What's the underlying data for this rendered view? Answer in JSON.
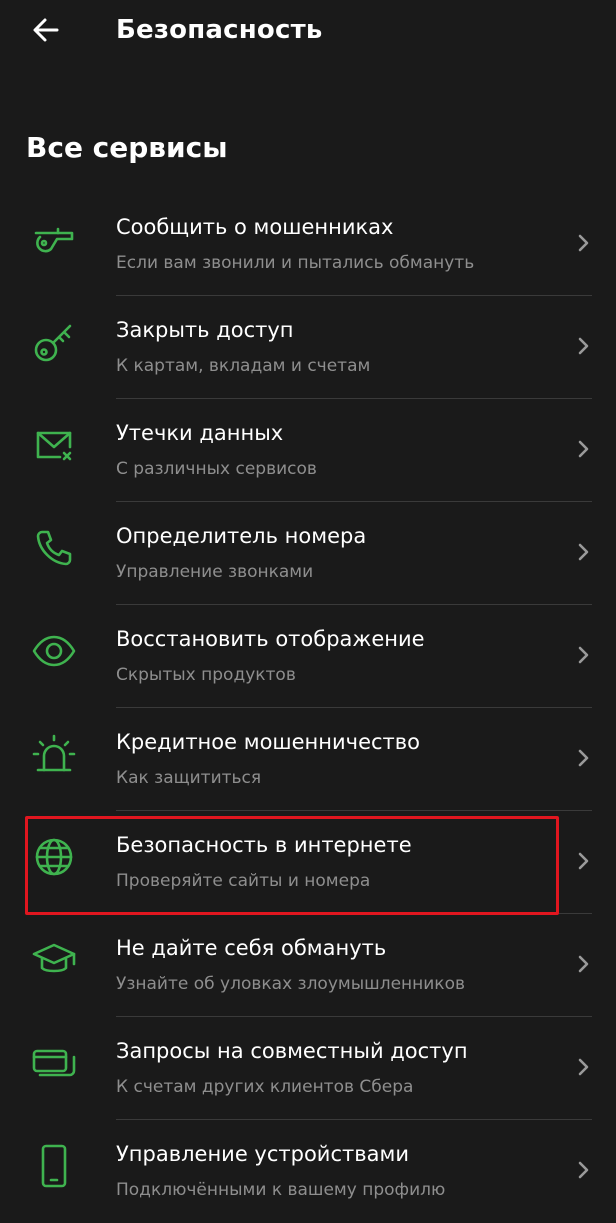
{
  "header": {
    "title": "Безопасность",
    "back_icon": "arrow-left-icon"
  },
  "section": {
    "title": "Все сервисы"
  },
  "colors": {
    "accent": "#3fb34f",
    "background": "#1a1a1a",
    "highlight": "#e0161f",
    "subtitle": "#8e8e8e"
  },
  "items": [
    {
      "title": "Сообщить о мошенниках",
      "subtitle": "Если вам звонили и пытались обмануть",
      "icon": "whistle-icon"
    },
    {
      "title": "Закрыть доступ",
      "subtitle": "К картам, вкладам и счетам",
      "icon": "key-icon"
    },
    {
      "title": "Утечки данных",
      "subtitle": "С различных сервисов",
      "icon": "envelope-alert-icon"
    },
    {
      "title": "Определитель номера",
      "subtitle": "Управление звонками",
      "icon": "phone-icon"
    },
    {
      "title": "Восстановить отображение",
      "subtitle": "Скрытых продуктов",
      "icon": "eye-icon"
    },
    {
      "title": "Кредитное мошенничество",
      "subtitle": "Как защититься",
      "icon": "siren-icon"
    },
    {
      "title": "Безопасность в интернете",
      "subtitle": "Проверяйте сайты и номера",
      "icon": "globe-icon"
    },
    {
      "title": "Не дайте себя обмануть",
      "subtitle": "Узнайте об уловках злоумышленников",
      "icon": "graduation-cap-icon"
    },
    {
      "title": "Запросы на совместный доступ",
      "subtitle": "К счетам других клиентов Сбера",
      "icon": "cards-icon"
    },
    {
      "title": "Управление устройствами",
      "subtitle": "Подключёнными к вашему профилю",
      "icon": "smartphone-icon"
    }
  ]
}
